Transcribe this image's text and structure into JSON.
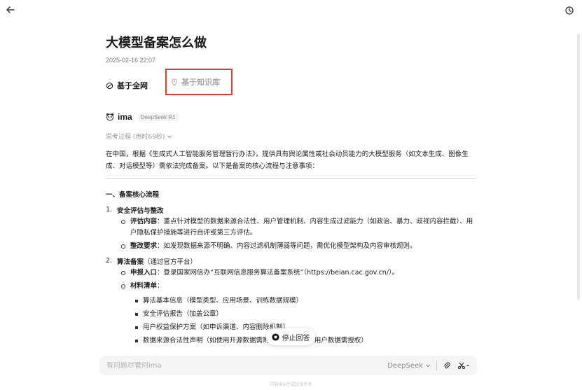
{
  "article": {
    "title": "大模型备案怎么做",
    "timestamp": "2025-02-16 22:07"
  },
  "tabs": [
    {
      "label": "基于全网",
      "icon": "globe-icon"
    },
    {
      "label": "基于知识库",
      "icon": "location-pin-icon"
    }
  ],
  "model": {
    "name": "ima",
    "tag": "DeepSeek R1",
    "icon": "panda-icon"
  },
  "thinking": "思考过程 (用时69秒)",
  "content": {
    "intro": "在中国，根据《生成式人工智能服务管理暂行办法》，提供具有舆论属性或社会动员能力的大模型服务（如文本生成、图像生成、对话模型等）需依法完成备案。以下是备案的核心流程与注意事项：",
    "section1_title": "一、备案核心流程",
    "item1": {
      "num": "1.",
      "title": "安全评估与整改",
      "subs": [
        {
          "label": "评估内容",
          "text": "：重点针对模型的数据来源合法性、用户管理机制、内容生成过滤能力（如政治、暴力、歧视内容拦截）、用户隐私保护措施等进行自评或第三方评估。"
        },
        {
          "label": "整改要求",
          "text": "：如发现数据来源不明确、内容过滤机制薄弱等问题，需优化模型架构及内容审核规则。"
        }
      ]
    },
    "item2": {
      "num": "2.",
      "title": "算法备案",
      "title_note": "（通过官方平台）",
      "subs": [
        {
          "label": "申报入口",
          "text": "：登录国家网信办“互联网信息服务算法备案系统”（https://beian.cac.gov.cn/）。"
        },
        {
          "label": "材料清单",
          "text": "："
        }
      ],
      "materials": [
        "算法基本信息（模型类型、应用场景、训练数据规模）",
        "安全评估报告（加盖公章）",
        "用户权益保护方案（如申诉渠道、内容删除机制）",
        "数据来源合法性声明（如使用开源数据需附许可License，用户数据需授权）"
      ]
    }
  },
  "stop_button": {
    "label": "停止回答"
  },
  "input": {
    "placeholder": "有问题尽管问ima",
    "model_select": "DeepSeek"
  },
  "footer": "内容由AI生成仅供参考"
}
